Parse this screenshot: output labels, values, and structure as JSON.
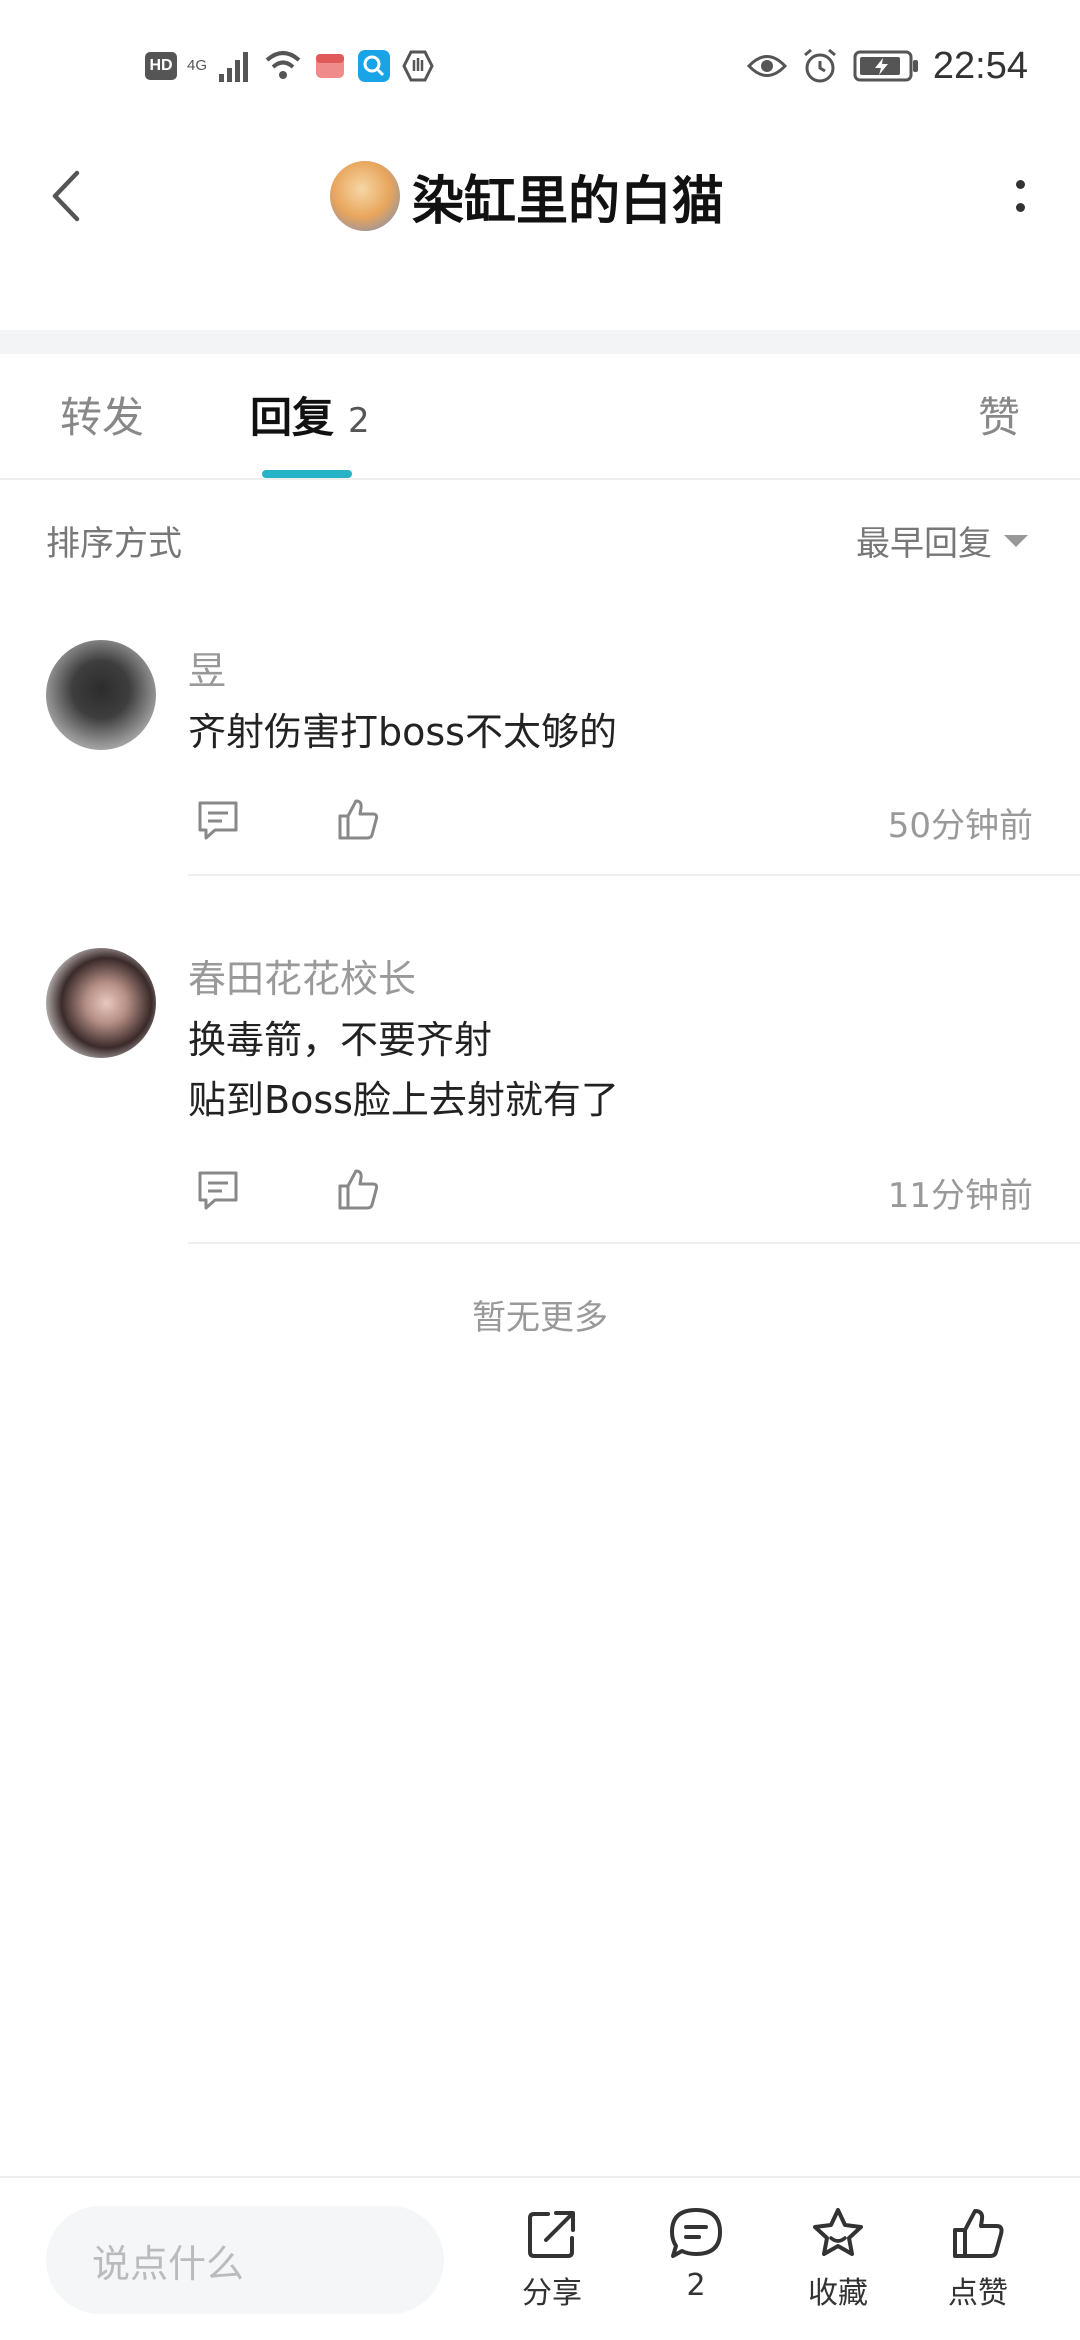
{
  "status_bar": {
    "hd": "HD",
    "network": "4G",
    "time": "22:54"
  },
  "header": {
    "title": "染缸里的白猫"
  },
  "tabs": {
    "forward": "转发",
    "reply": "回复",
    "reply_count": "2",
    "like": "赞",
    "active": "reply"
  },
  "sort": {
    "label": "排序方式",
    "value": "最早回复"
  },
  "comments": [
    {
      "name": "昱",
      "lines": [
        "齐射伤害打boss不太够的"
      ],
      "time": "50分钟前"
    },
    {
      "name": "春田花花校长",
      "lines": [
        "换毒箭，不要齐射",
        "贴到Boss脸上去射就有了"
      ],
      "time": "11分钟前"
    }
  ],
  "no_more": "暂无更多",
  "bottom_bar": {
    "input_placeholder": "说点什么",
    "share": "分享",
    "comment_count": "2",
    "favorite": "收藏",
    "like": "点赞"
  },
  "colors": {
    "accent": "#26b3c6",
    "text_primary": "#222222",
    "text_secondary": "#999999"
  }
}
